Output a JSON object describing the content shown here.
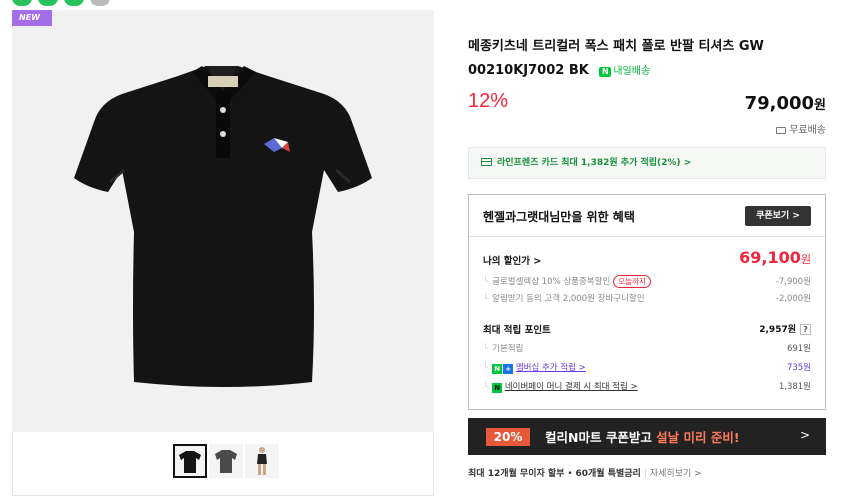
{
  "badge": "NEW",
  "product": {
    "title": "메종키츠네 트리컬러 폭스 패치 폴로 반팔 티셔츠 GW 00210KJ7002 BK",
    "delivery_label": "내일배송",
    "delivery_icon": "N",
    "discount": "12%",
    "price": "79,000",
    "price_unit": "원",
    "free_shipping": "무료배송"
  },
  "card_promo": "라인프렌즈 카드 최대 1,382원 추가 적립(2%) >",
  "benefits": {
    "title": "헨젤과그랫대님만을 위한 혜택",
    "coupon_button": "쿠폰보기 >",
    "my_price_label": "나의 할인가 >",
    "my_price": "69,100",
    "my_price_unit": "원",
    "discount_lines": [
      {
        "label": "글로벌셀렉샵 10% 상품중복할인",
        "pill": "오늘까지",
        "value": "-7,900원"
      },
      {
        "label": "알림받기 동의 고객 2,000원 장바구니할인",
        "value": "-2,000원"
      }
    ],
    "points_label": "최대 적립 포인트",
    "points_total": "2,957원",
    "points_help": "?",
    "point_lines": [
      {
        "label": "기본적립",
        "value": "691원"
      },
      {
        "label": "멤버십 추가 적립 >",
        "icon_a": "N",
        "icon_b": "+",
        "value": "735원"
      },
      {
        "label": "네이버페이 머니 결제 시 최대 적립 >",
        "icon": "N",
        "value": "1,381원"
      }
    ]
  },
  "promo": {
    "pct": "20%",
    "text_white": "컬리N마트 쿠폰받고 ",
    "text_highlight": "설날 미리 준비!",
    "arrow": ">"
  },
  "installment": {
    "bold_1": "최대 12개월 무이자 할부",
    "mid": " • ",
    "bold_2": "60개월 특별금리",
    "more": "자세히보기 >"
  },
  "colors": {
    "accent_red": "#f0273d",
    "naver_green": "#00c73c",
    "badge_purple": "#a36ee8"
  }
}
